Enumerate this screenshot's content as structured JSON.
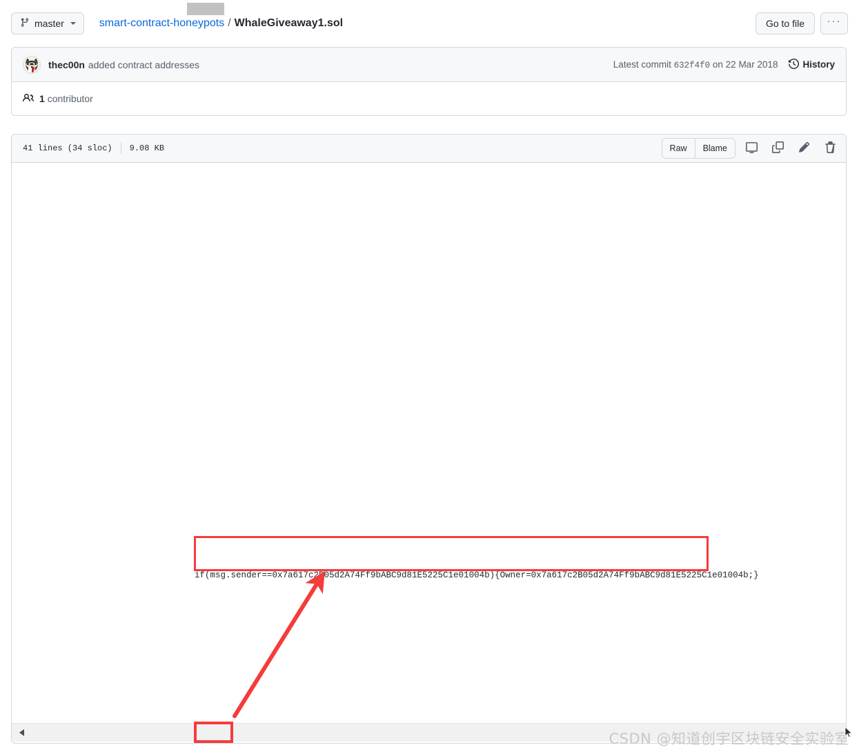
{
  "topbar": {
    "branch": {
      "label": "master",
      "icon": "git-branch-icon",
      "caret": "chevron-down-icon"
    },
    "breadcrumb": {
      "repo": "smart-contract-honeypots",
      "separator": "/",
      "file": "WhaleGiveaway1.sol"
    },
    "go_to_file_label": "Go to file",
    "kebab_label": "···"
  },
  "commit": {
    "author": "thec00n",
    "message": "added contract addresses",
    "latest_commit_prefix": "Latest commit",
    "sha": "632f4f0",
    "date_prefix": "on",
    "date": "22 Mar 2018",
    "history_label": "History",
    "contributors_count": "1",
    "contributors_label": "contributor"
  },
  "file": {
    "lines": "41 lines (34 sloc)",
    "size": "9.08 KB",
    "raw_label": "Raw",
    "blame_label": "Blame",
    "icons": [
      "desktop-icon",
      "copy-icon",
      "pencil-icon",
      "trash-icon"
    ]
  },
  "code": {
    "visible_line": "if(msg.sender==0x7a617c2B05d2A74Ff9bABC9d81E5225C1e01004b){Owner=0x7a617c2B05d2A74Ff9bABC9d81E5225C1e01004b;}"
  },
  "annotation": {
    "color": "#f63b3b",
    "arrow": "red-arrow-annotation",
    "box_target": "code-line-highlight",
    "thumb_target": "scrollbar-thumb-highlight"
  },
  "watermark": {
    "text": "CSDN @知道创宇区块链安全实验室"
  },
  "colors": {
    "link": "#0969da",
    "header_bg": "#f6f8fa",
    "border": "#d0d7de",
    "annotation_red": "#f63b3b",
    "scrollbar_thumb": "#c1c1c1"
  }
}
